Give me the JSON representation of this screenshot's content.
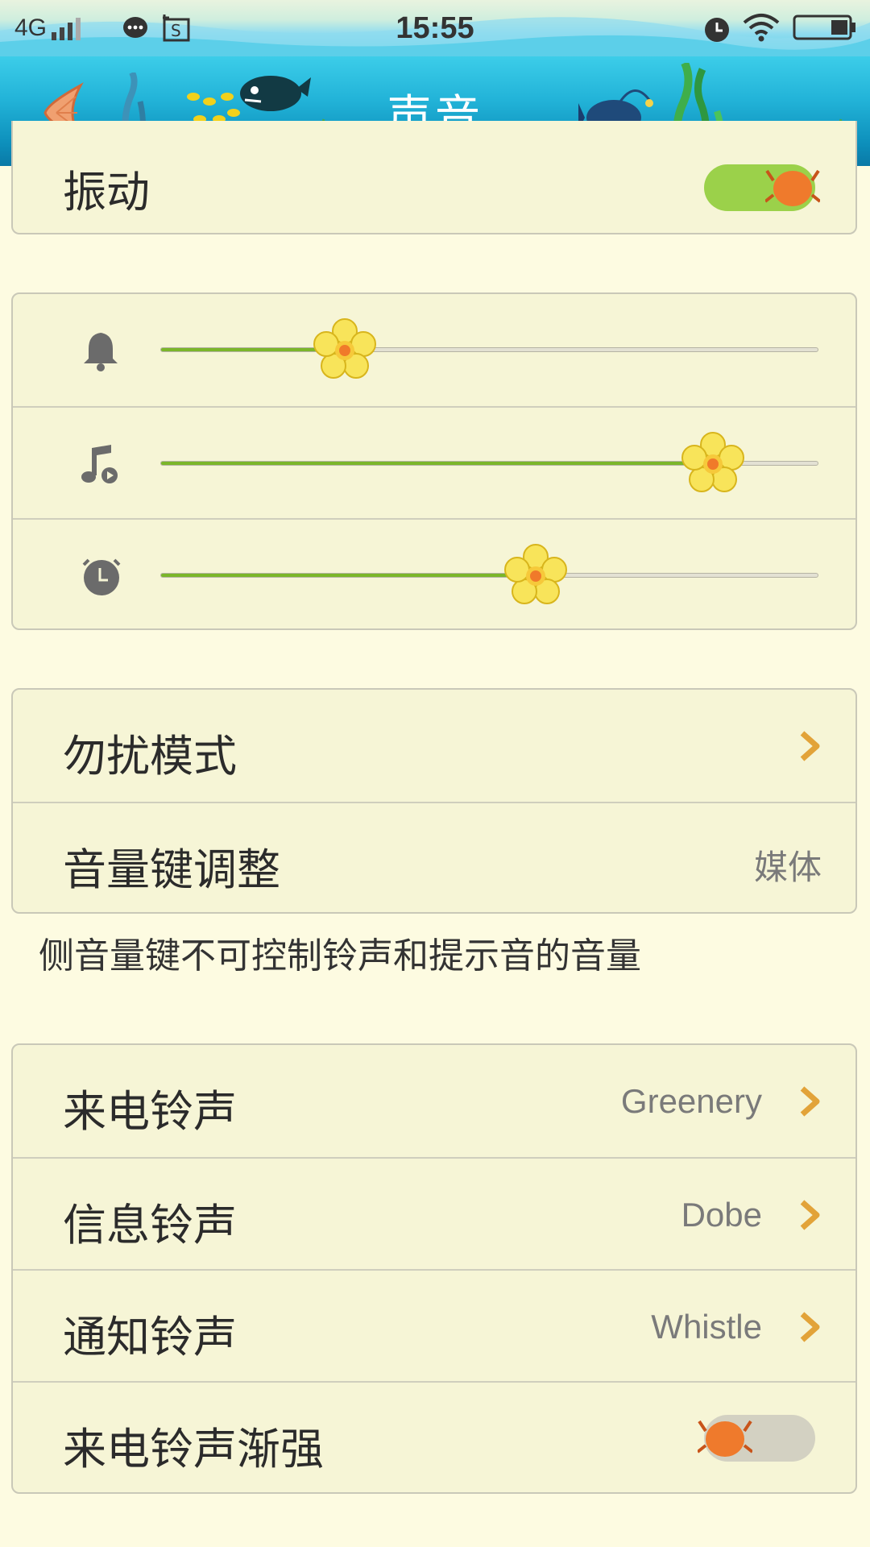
{
  "status_bar": {
    "network": "4G",
    "time": "15:55"
  },
  "title_bar": {
    "title": "声音"
  },
  "vibration": {
    "label": "振动",
    "on": true
  },
  "volume_sliders": [
    {
      "icon": "bell-icon",
      "value": 0.28
    },
    {
      "icon": "music-note-icon",
      "value": 0.84
    },
    {
      "icon": "alarm-clock-icon",
      "value": 0.57
    }
  ],
  "settings_group_1": [
    {
      "label": "勿扰模式",
      "value": "",
      "has_arrow": true
    },
    {
      "label": "音量键调整",
      "value": "媒体",
      "has_arrow": false
    }
  ],
  "hint": "侧音量键不可控制铃声和提示音的音量",
  "settings_group_2": [
    {
      "label": "来电铃声",
      "value": "Greenery",
      "has_arrow": true
    },
    {
      "label": "信息铃声",
      "value": "Dobe",
      "has_arrow": true
    },
    {
      "label": "通知铃声",
      "value": "Whistle",
      "has_arrow": true
    }
  ],
  "ring_fade_in": {
    "label": "来电铃声渐强",
    "on": false
  },
  "colors": {
    "accent_green": "#7bb62a",
    "toggle_on": "#9bd14a",
    "toggle_off": "#d3d1c2",
    "crab": "#ef7a2c",
    "chevron": "#e2a339",
    "background": "#fdfbe1",
    "card": "#f6f5d6"
  }
}
